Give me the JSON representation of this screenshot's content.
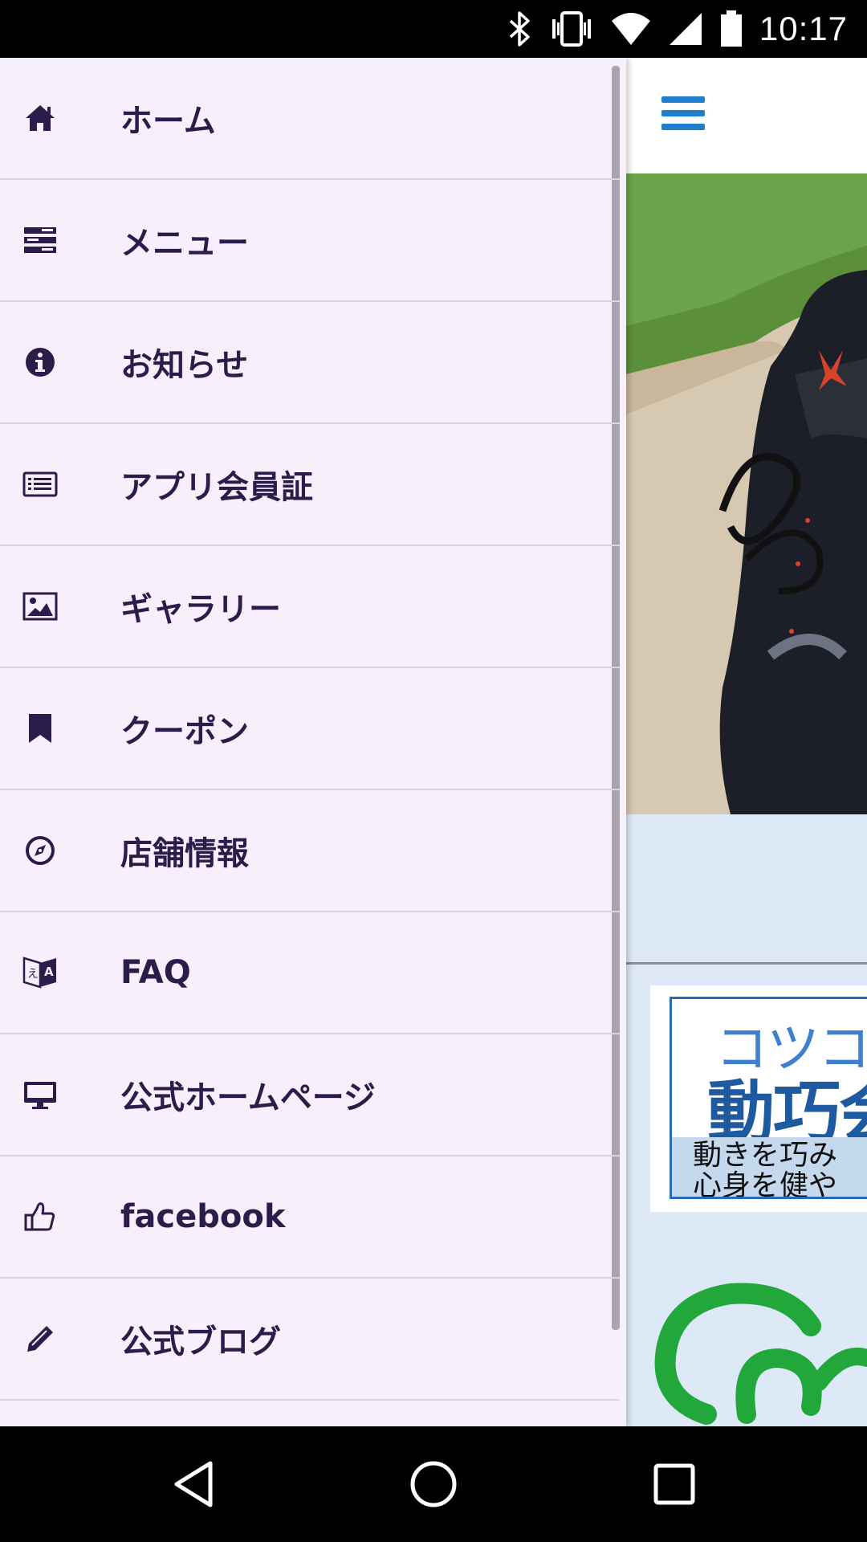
{
  "status_bar": {
    "time": "10:17",
    "icons": [
      "bluetooth-icon",
      "vibrate-icon",
      "wifi-icon",
      "signal-icon",
      "battery-icon"
    ]
  },
  "drawer": {
    "items": [
      {
        "label": "ホーム",
        "icon": "home-icon"
      },
      {
        "label": "メニュー",
        "icon": "menu-list-icon"
      },
      {
        "label": "お知らせ",
        "icon": "info-icon"
      },
      {
        "label": "アプリ会員証",
        "icon": "member-card-icon"
      },
      {
        "label": "ギャラリー",
        "icon": "gallery-icon"
      },
      {
        "label": "クーポン",
        "icon": "bookmark-icon"
      },
      {
        "label": "店舗情報",
        "icon": "compass-icon"
      },
      {
        "label": "FAQ",
        "icon": "translate-icon"
      },
      {
        "label": "公式ホームページ",
        "icon": "monitor-icon"
      },
      {
        "label": "facebook",
        "icon": "thumbs-up-icon"
      },
      {
        "label": "公式ブログ",
        "icon": "pencil-icon"
      }
    ]
  },
  "app": {
    "menu_icon": "hamburger-icon",
    "banner": {
      "line1": "コツコ",
      "line2": "動巧会",
      "sub": "動きを巧み\n心身を健や"
    }
  },
  "nav_bar": {
    "icons": [
      "back-icon",
      "home-circle-icon",
      "recents-icon"
    ]
  },
  "colors": {
    "drawer_bg": "#f6effc",
    "menu_text": "#2a1d4a",
    "accent_blue": "#1f7fcf",
    "banner_blue": "#1d5aa0"
  }
}
